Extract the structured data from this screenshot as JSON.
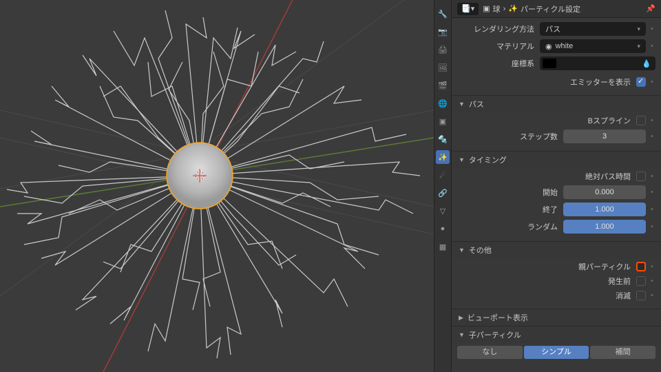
{
  "header": {
    "object": "球",
    "settings": "パーティクル設定"
  },
  "render": {
    "label": "レンダリング方法",
    "value": "パス"
  },
  "material": {
    "label": "マテリアル",
    "value": "white"
  },
  "coord": {
    "label": "座標系"
  },
  "emitter": {
    "label": "エミッターを表示"
  },
  "sections": {
    "path": "パス",
    "timing": "タイミング",
    "other": "その他",
    "viewport": "ビューポート表示",
    "children": "子パーティクル"
  },
  "path": {
    "bspline_label": "Bスプライン",
    "steps_label": "ステップ数",
    "steps": "3"
  },
  "timing": {
    "abs_label": "絶対パス時間",
    "start_label": "開始",
    "start": "0.000",
    "end_label": "終了",
    "end": "1.000",
    "random_label": "ランダム",
    "random": "1.000"
  },
  "other": {
    "parent_label": "親パーティクル",
    "prebirth_label": "発生前",
    "fade_label": "消滅"
  },
  "children": {
    "none": "なし",
    "simple": "シンプル",
    "interp": "補間"
  },
  "chart_data": null
}
